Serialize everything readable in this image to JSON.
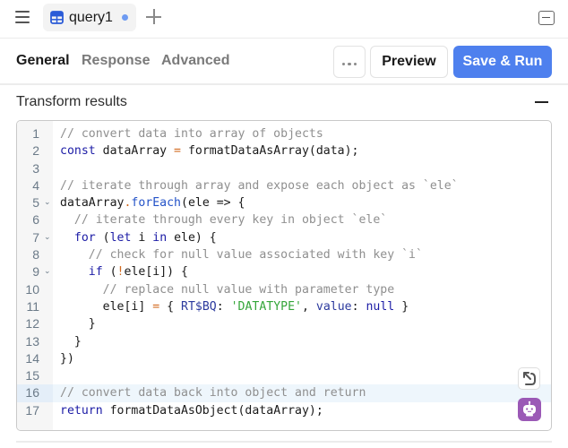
{
  "topbar": {
    "menu_icon": "hamburger-menu-icon",
    "tab": {
      "label": "query1",
      "icon": "table-icon",
      "unsaved_indicator": true,
      "accent_color": "#2b5bd7"
    },
    "new_tab_icon": "plus-icon",
    "collapse_panel_icon": "minimize-panel-icon"
  },
  "subtabs": [
    {
      "label": "General",
      "active": true
    },
    {
      "label": "Response",
      "active": false
    },
    {
      "label": "Advanced",
      "active": false
    }
  ],
  "toolbar": {
    "more_icon": "ellipsis-icon",
    "preview_label": "Preview",
    "save_run_label": "Save & Run",
    "save_run_color": "#4e80ee"
  },
  "section": {
    "title": "Transform results",
    "collapse_icon": "minus-icon"
  },
  "editor": {
    "active_line": 16,
    "lines": [
      {
        "n": "1",
        "fold": false,
        "text": "// convert data into array of objects"
      },
      {
        "n": "2",
        "fold": false,
        "text": "const dataArray = formatDataAsArray(data);"
      },
      {
        "n": "3",
        "fold": false,
        "text": ""
      },
      {
        "n": "4",
        "fold": false,
        "text": "// iterate through array and expose each object as `ele`"
      },
      {
        "n": "5",
        "fold": true,
        "text": "dataArray.forEach(ele => {"
      },
      {
        "n": "6",
        "fold": false,
        "text": "  // iterate through every key in object `ele`"
      },
      {
        "n": "7",
        "fold": true,
        "text": "  for (let i in ele) {"
      },
      {
        "n": "8",
        "fold": false,
        "text": "    // check for null value associated with key `i`"
      },
      {
        "n": "9",
        "fold": true,
        "text": "    if (!ele[i]) {"
      },
      {
        "n": "10",
        "fold": false,
        "text": "      // replace null value with parameter type"
      },
      {
        "n": "11",
        "fold": false,
        "text": "      ele[i] = { RT$BQ: 'DATATYPE', value: null }"
      },
      {
        "n": "12",
        "fold": false,
        "text": "    }"
      },
      {
        "n": "13",
        "fold": false,
        "text": "  }"
      },
      {
        "n": "14",
        "fold": false,
        "text": "})"
      },
      {
        "n": "15",
        "fold": false,
        "text": ""
      },
      {
        "n": "16",
        "fold": false,
        "text": "// convert data back into object and return"
      },
      {
        "n": "17",
        "fold": false,
        "text": "return formatDataAsObject(dataArray);"
      }
    ],
    "fold_glyph": "⌄",
    "tools": [
      {
        "icon": "refactor-icon"
      },
      {
        "icon": "ai-assistant-robot-icon",
        "color": "#9b59b6"
      }
    ]
  }
}
